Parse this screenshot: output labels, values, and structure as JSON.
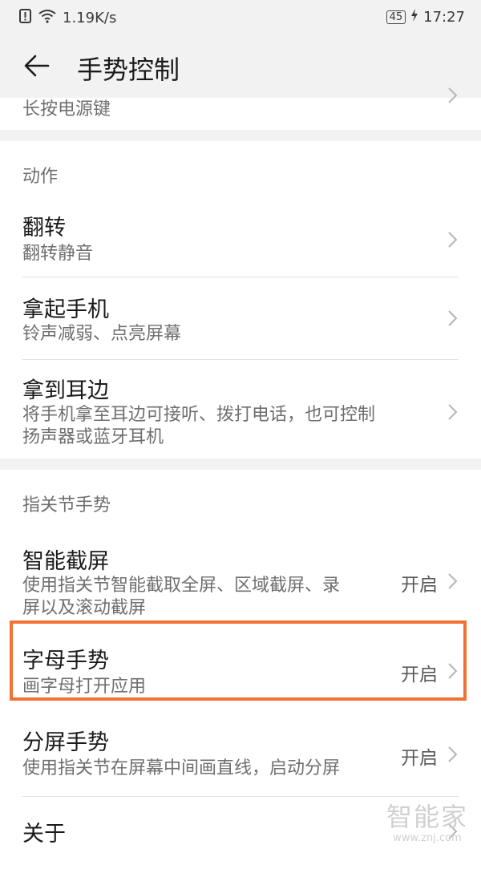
{
  "status_bar": {
    "speed": "1.19K/s",
    "battery": "45",
    "time": "17:27"
  },
  "app_bar": {
    "title": "手势控制"
  },
  "partial_row": {
    "subtitle": "长按电源键"
  },
  "sections": [
    {
      "header": "动作",
      "items": [
        {
          "title": "翻转",
          "subtitle": "翻转静音",
          "value": ""
        },
        {
          "title": "拿起手机",
          "subtitle": "铃声减弱、点亮屏幕",
          "value": ""
        },
        {
          "title": "拿到耳边",
          "subtitle_lines": [
            "将手机拿至耳边可接听、拨打电话，也可控制",
            "扬声器或蓝牙耳机"
          ],
          "value": ""
        }
      ]
    },
    {
      "header": "指关节手势",
      "items": [
        {
          "title": "智能截屏",
          "subtitle_lines": [
            "使用指关节智能截取全屏、区域截屏、录",
            "屏以及滚动截屏"
          ],
          "value": "开启"
        },
        {
          "title": "字母手势",
          "subtitle": "画字母打开应用",
          "value": "开启"
        },
        {
          "title": "分屏手势",
          "subtitle": "使用指关节在屏幕中间画直线，启动分屏",
          "value": "开启"
        },
        {
          "title": "关于"
        }
      ]
    }
  ],
  "watermark": {
    "text": "智能家",
    "url": "www.znj.com"
  },
  "colors": {
    "highlight": "#f07234",
    "background_gray": "#f2f2f2"
  },
  "icons": [
    "alert-icon",
    "wifi-icon",
    "battery-icon",
    "charging-icon",
    "back-arrow-icon",
    "chevron-right-icon"
  ]
}
